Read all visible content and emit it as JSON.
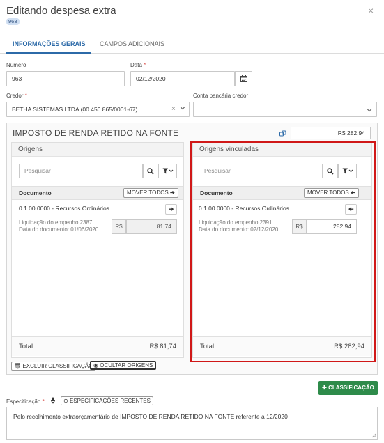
{
  "header": {
    "title": "Editando despesa extra",
    "badge": "963",
    "close_label": "×"
  },
  "tabs": [
    {
      "label": "INFORMAÇÕES GERAIS",
      "active": true
    },
    {
      "label": "CAMPOS ADICIONAIS",
      "active": false
    }
  ],
  "form": {
    "numero_label": "Número",
    "numero_value": "963",
    "data_label": "Data",
    "data_value": "02/12/2020",
    "credor_label": "Credor",
    "credor_value": "BETHA SISTEMAS LTDA (00.456.865/0001-67)",
    "conta_label": "Conta bancária credor",
    "conta_value": "",
    "required_mark": "*"
  },
  "classificacao": {
    "title": "IMPOSTO DE RENDA RETIDO NA FONTE",
    "valor": "R$ 282,94",
    "origens": {
      "title": "Origens",
      "search_placeholder": "Pesquisar",
      "col_label": "Documento",
      "move_all_label": "MOVER TODOS",
      "items": [
        {
          "name": "0.1.00.0000 - Recursos Ordinários",
          "meta1": "Liquidação do empenho 2387",
          "meta2": "Data do documento: 01/06/2020",
          "currency": "R$",
          "value": "81,74"
        }
      ],
      "total_label": "Total",
      "total_value": "R$ 81,74"
    },
    "vinculadas": {
      "title": "Origens vinculadas",
      "search_placeholder": "Pesquisar",
      "col_label": "Documento",
      "move_all_label": "MOVER TODOS",
      "items": [
        {
          "name": "0.1.00.0000 - Recursos Ordinários",
          "meta1": "Liquidação do empenho 2391",
          "meta2": "Data do documento: 02/12/2020",
          "currency": "R$",
          "value": "282,94"
        }
      ],
      "total_label": "Total",
      "total_value": "R$ 282,94"
    },
    "excluir_label": "EXCLUIR CLASSIFICAÇÃO",
    "ocultar_label": "OCULTAR ORIGENS"
  },
  "add_classificacao_label": "CLASSIFICAÇÃO",
  "especificacao": {
    "label": "Especificação",
    "recentes_label": "ESPECIFICAÇÕES RECENTES",
    "text": "Pelo recolhimento extraorçamentário de IMPOSTO DE RENDA RETIDO NA FONTE referente a 12/2020"
  },
  "colors": {
    "accent": "#2c6aa8",
    "highlight": "#d01818",
    "success": "#2e8b4a"
  }
}
